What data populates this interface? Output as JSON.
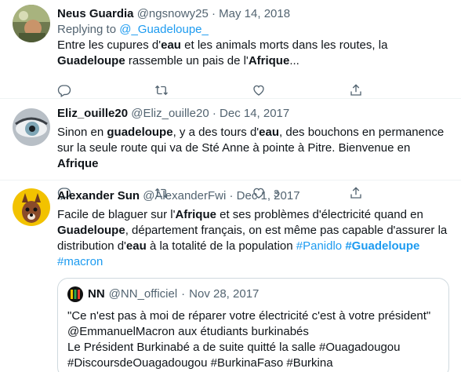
{
  "tweets": [
    {
      "name": "Neus Guardia",
      "handle": "@ngsnowy25",
      "separator": "·",
      "date": "May 14, 2018",
      "replying_prefix": "Replying to",
      "replying_handle": "@_Guadeloupe_",
      "text_parts": [
        {
          "t": "Entre les cupures d'",
          "s": "n"
        },
        {
          "t": "eau",
          "s": "b"
        },
        {
          "t": " et les animals morts dans les routes, la ",
          "s": "n"
        },
        {
          "t": "Guadeloupe",
          "s": "b"
        },
        {
          "t": " rassemble un pais de l'",
          "s": "n"
        },
        {
          "t": "Afrique",
          "s": "b"
        },
        {
          "t": "...",
          "s": "n"
        }
      ],
      "like_count": ""
    },
    {
      "name": "Eliz_ouille20",
      "handle": "@Eliz_ouille20",
      "separator": "·",
      "date": "Dec 14, 2017",
      "text_parts": [
        {
          "t": "Sinon en ",
          "s": "n"
        },
        {
          "t": "guadeloupe",
          "s": "b"
        },
        {
          "t": ", y a des tours d'",
          "s": "n"
        },
        {
          "t": "eau",
          "s": "b"
        },
        {
          "t": ", des bouchons en permanence sur la seule route qui va de Sté Anne à pointe à Pitre. Bienvenue en ",
          "s": "n"
        },
        {
          "t": "Afrique",
          "s": "b"
        }
      ],
      "like_count": "3"
    },
    {
      "name": "Alexander Sun",
      "handle": "@AlexanderFwi",
      "separator": "·",
      "date": "Dec 1, 2017",
      "text_parts": [
        {
          "t": "Facile de blaguer sur l'",
          "s": "n"
        },
        {
          "t": "Afrique",
          "s": "b"
        },
        {
          "t": " et ses problèmes d'électricité quand en ",
          "s": "n"
        },
        {
          "t": "Guadeloupe",
          "s": "b"
        },
        {
          "t": ", département français, on est même pas capable d'assurer la distribution d'",
          "s": "n"
        },
        {
          "t": "eau",
          "s": "b"
        },
        {
          "t": " à la totalité de la population ",
          "s": "n"
        },
        {
          "t": "#Panidlo",
          "s": "h"
        },
        {
          "t": " ",
          "s": "n"
        },
        {
          "t": "#Guadeloupe",
          "s": "hb"
        },
        {
          "t": " ",
          "s": "n"
        },
        {
          "t": "#macron",
          "s": "h"
        }
      ],
      "quote": {
        "name": "NN",
        "handle": "@NN_officiel",
        "separator": "·",
        "date": "Nov 28, 2017",
        "lines": [
          "\"Ce n'est pas à moi de réparer votre électricité c'est à votre président\"",
          "@EmmanuelMacron aux étudiants burkinabés",
          "Le Président Burkinabé a de suite quitté la salle #Ouagadougou",
          "#DiscoursdeOuagadougou #BurkinaFaso #Burkina"
        ]
      }
    }
  ],
  "icons": [
    "reply-icon",
    "retweet-icon",
    "like-icon",
    "share-icon"
  ],
  "colors": {
    "link": "#1d9bf0",
    "muted": "#536471",
    "text": "#0f1419",
    "divider": "#eff3f4"
  }
}
